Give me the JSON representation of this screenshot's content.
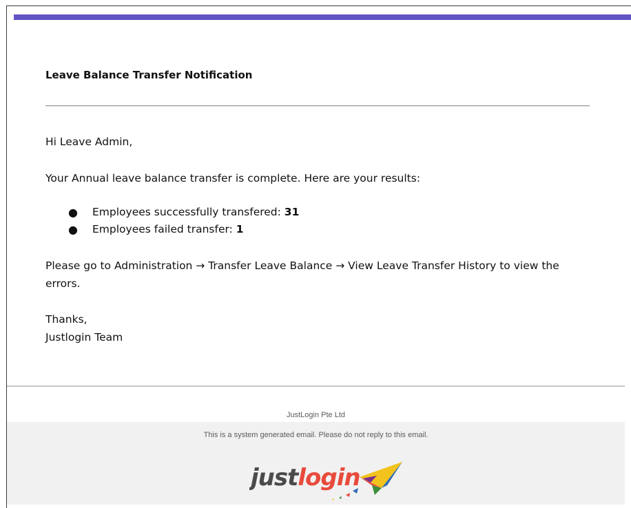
{
  "email": {
    "title": "Leave Balance Transfer Notification",
    "greeting": "Hi Leave Admin,",
    "intro": "Your Annual leave balance transfer is complete. Here are your results:",
    "results": [
      {
        "label": "Employees successfully transfered: ",
        "value": "31"
      },
      {
        "label": "Employees failed transfer: ",
        "value": "1"
      }
    ],
    "instructions": "Please go to Administration → Transfer Leave Balance → View Leave Transfer History to view the errors.",
    "sign_off": "Thanks,",
    "signature": "Justlogin Team"
  },
  "footer": {
    "company": "JustLogin Pte Ltd",
    "note": "This is a system generated email. Please do not reply to this email.",
    "logo_text_prefix": "just",
    "logo_text_suffix": "login"
  },
  "colors": {
    "accent_bar": "#6153c4",
    "logo_dark": "#4a4a4a",
    "logo_red": "#e84a3c"
  }
}
